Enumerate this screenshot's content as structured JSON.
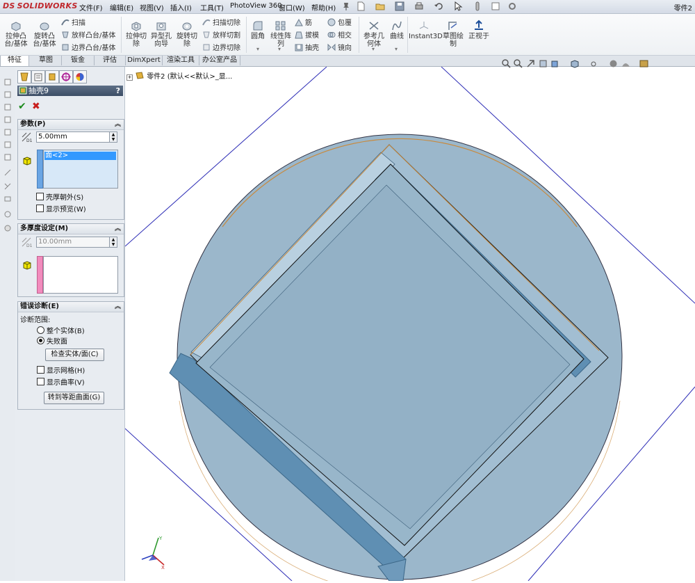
{
  "app": {
    "logo_prefix": "DS",
    "logo_text": "SOLIDWORKS",
    "document_title": "零件2"
  },
  "menu": [
    "文件(F)",
    "编辑(E)",
    "视图(V)",
    "插入(I)",
    "工具(T)",
    "PhotoView 360",
    "窗口(W)",
    "帮助(H)"
  ],
  "commands": {
    "extrude_boss": "拉伸凸\n台/基体",
    "revolve_boss": "旋转凸\n台/基体",
    "sweep": "扫描",
    "loft_boss": "放样凸台/基体",
    "boundary_boss": "边界凸台/基体",
    "extrude_cut": "拉伸切\n除",
    "hole_wizard": "异型孔\n向导",
    "revolve_cut": "旋转切\n除",
    "swept_cut": "扫描切除",
    "lofted_cut": "放样切割",
    "boundary_cut": "边界切除",
    "fillet": "圆角",
    "linear_pattern": "线性阵\n列",
    "rib": "筋",
    "draft": "拔模",
    "shell": "抽壳",
    "wrap": "包覆",
    "intersect": "相交",
    "mirror": "镜向",
    "ref_geometry": "参考几\n何体",
    "curves": "曲线",
    "instant3d": "Instant3D",
    "sketch_drawing": "草图绘\n制",
    "normal_to": "正视于"
  },
  "tabs": [
    "特征",
    "草图",
    "钣金",
    "评估",
    "DimXpert",
    "渲染工具",
    "办公室产品"
  ],
  "active_tab": "特征",
  "property_manager": {
    "feature_title": "抽壳9",
    "help": "?",
    "ok": "✔",
    "cancel": "✖",
    "parameters": {
      "title": "参数(P)",
      "thickness": "5.00mm",
      "faces": [
        "面<2>"
      ],
      "shell_outward": "壳厚朝外(S)",
      "show_preview": "显示预览(W)"
    },
    "multi_thickness": {
      "title": "多厚度设定(M)",
      "thickness": "10.00mm"
    },
    "error_diagnosis": {
      "title": "错误诊断(E)",
      "scope_label": "诊断范围:",
      "option_all": "整个实体(B)",
      "option_failed": "失败面",
      "check_button": "检查实体/面(C)",
      "show_mesh": "显示网格(H)",
      "show_curvature": "显示曲率(V)",
      "offset_button": "转到等距曲面(G)"
    }
  },
  "tree": {
    "root": "零件2 (默认<<默认>_显..."
  },
  "colors": {
    "model_fill": "#9bb7cb",
    "model_dark": "#5f8fb3",
    "plane_line": "#2b2bb5",
    "edge_orange": "#c9893b",
    "selection": "#3399ff"
  }
}
